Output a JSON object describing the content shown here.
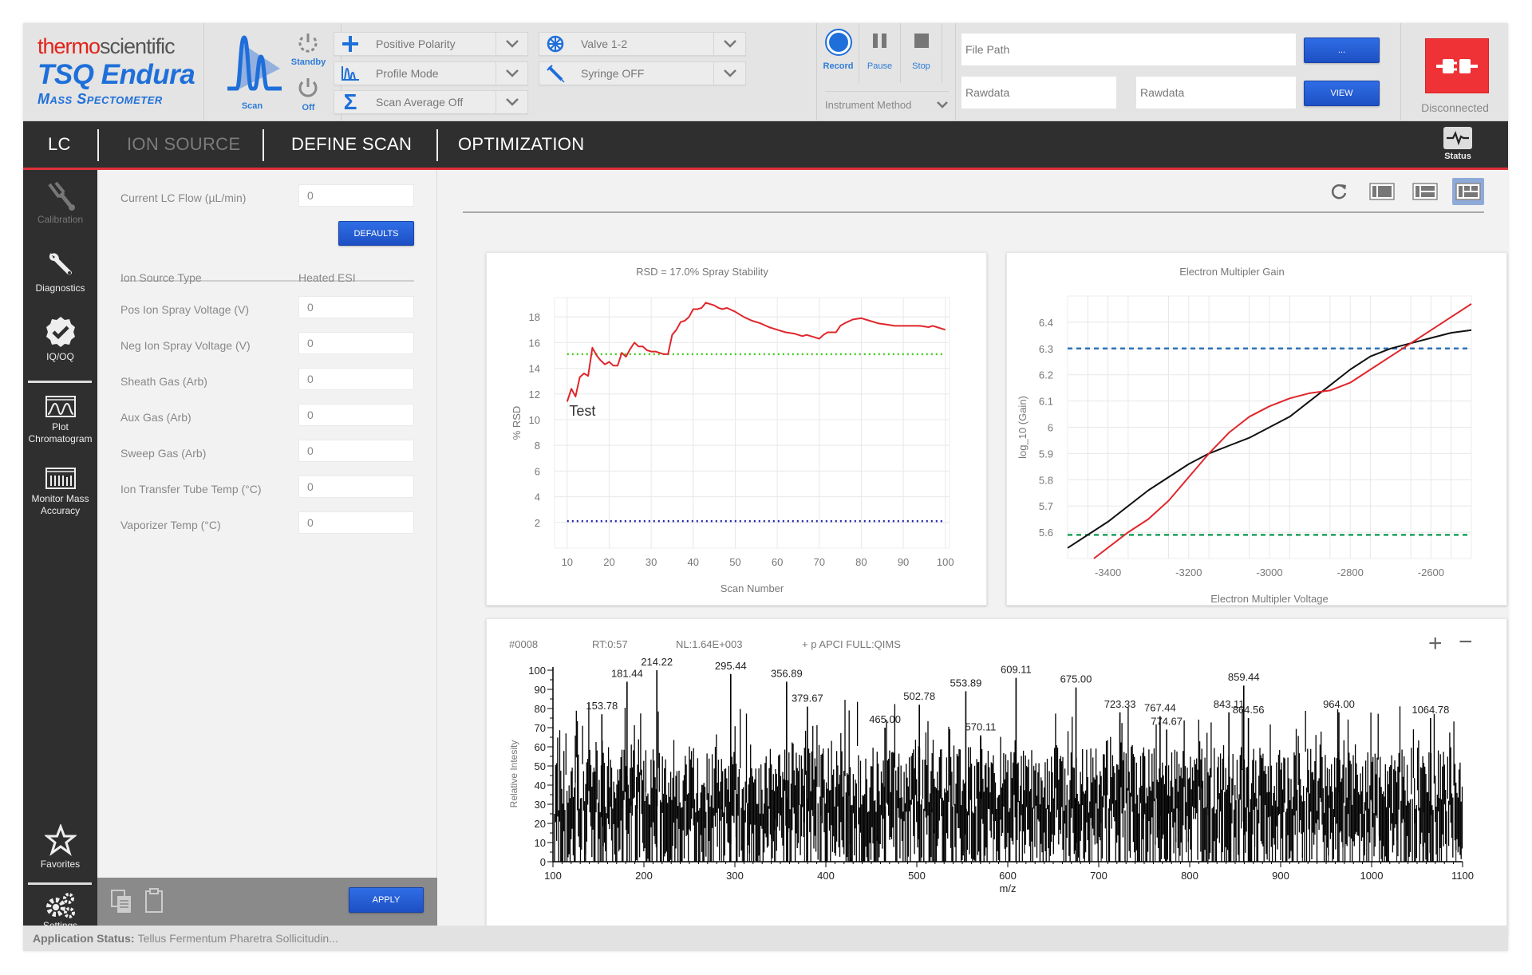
{
  "brand": {
    "company_part1": "thermo",
    "company_part2": "scientific",
    "product": "TSQ Endura",
    "subtitle": "Mass Spectometer"
  },
  "scan_controls": {
    "scan_label": "Scan",
    "standby_label": "Standby",
    "off_label": "Off"
  },
  "dropdowns": [
    {
      "icon": "plus-icon",
      "label": "Positive Polarity"
    },
    {
      "icon": "profile-peak-icon",
      "label": "Profile Mode"
    },
    {
      "icon": "sigma-icon",
      "label": "Scan Average Off"
    },
    {
      "icon": "valve-icon",
      "label": "Valve 1-2"
    },
    {
      "icon": "syringe-icon",
      "label": "Syringe OFF"
    }
  ],
  "recording": {
    "record_label": "Record",
    "pause_label": "Pause",
    "stop_label": "Stop",
    "instrument_method_label": "Instrument Method"
  },
  "file": {
    "file_path_placeholder": "File Path",
    "rawdata1_placeholder": "Rawdata",
    "rawdata2_placeholder": "Rawdata",
    "browse_label": "...",
    "view_label": "VIEW"
  },
  "connection": {
    "status_label": "Disconnected",
    "color": "#ee3236"
  },
  "tabs": [
    {
      "label": "LC",
      "state": "normal"
    },
    {
      "label": "ION SOURCE",
      "state": "active-muted"
    },
    {
      "label": "DEFINE SCAN",
      "state": "normal"
    },
    {
      "label": "OPTIMIZATION",
      "state": "normal"
    }
  ],
  "status_button_label": "Status",
  "sidebar": {
    "items": [
      {
        "label": "Calibration",
        "icon": "tuning-fork-icon",
        "disabled": true
      },
      {
        "label": "Diagnostics",
        "icon": "wrench-icon",
        "disabled": false
      },
      {
        "label": "IQ/OQ",
        "icon": "check-badge-icon",
        "disabled": false
      },
      {
        "label": "Plot Chromatogram",
        "icon": "chromatogram-icon",
        "disabled": false
      },
      {
        "label": "Monitor Mass Accuracy",
        "icon": "mass-accuracy-icon",
        "disabled": false
      },
      {
        "label": "Favorites",
        "icon": "star-icon",
        "disabled": false
      },
      {
        "label": "Settings",
        "icon": "gears-icon",
        "disabled": false
      }
    ]
  },
  "left_panel": {
    "lc_flow_label": "Current LC Flow (µL/min)",
    "lc_flow_value": "0",
    "defaults_label": "DEFAULTS",
    "ion_source_type_label": "Ion Source Type",
    "ion_source_type_value": "Heated ESI",
    "fields": [
      {
        "label": "Pos Ion Spray Voltage (V)",
        "value": "0"
      },
      {
        "label": "Neg Ion Spray Voltage (V)",
        "value": "0"
      },
      {
        "label": "Sheath Gas (Arb)",
        "value": "0"
      },
      {
        "label": "Aux Gas (Arb)",
        "value": "0"
      },
      {
        "label": "Sweep Gas (Arb)",
        "value": "0"
      },
      {
        "label": "Ion Transfer Tube Temp (°C)",
        "value": "0"
      },
      {
        "label": "Vaporizer Temp (°C)",
        "value": "0"
      }
    ],
    "apply_label": "APPLY"
  },
  "app_status": {
    "label": "Application Status:",
    "text": "Tellus Fermentum Pharetra Sollicitudin..."
  },
  "view_tools": [
    {
      "icon": "refresh-icon",
      "active": false
    },
    {
      "icon": "layout-single-icon",
      "active": false
    },
    {
      "icon": "layout-split-icon",
      "active": false
    },
    {
      "icon": "layout-grid-icon",
      "active": true
    }
  ],
  "spectrum_zoom": {
    "zoom_in": "+",
    "zoom_out": "−"
  },
  "chart_data": [
    {
      "type": "line",
      "title": "RSD  = 17.0% Spray Stability",
      "xlabel": "Scan Number",
      "ylabel": "% RSD",
      "xlim": [
        7,
        101
      ],
      "ylim": [
        0,
        19.5
      ],
      "xticks": [
        10,
        20,
        30,
        40,
        50,
        60,
        70,
        80,
        90,
        100
      ],
      "yticks": [
        2,
        4,
        6,
        8,
        10,
        12,
        14,
        16,
        18
      ],
      "grid": true,
      "annotation": "Test",
      "series": [
        {
          "name": "RSD",
          "color": "#e0262b",
          "x": [
            10,
            11,
            12,
            13,
            14,
            15,
            16,
            17,
            18,
            19,
            20,
            21,
            22,
            23,
            24,
            25,
            26,
            27,
            28,
            29,
            30,
            31,
            32,
            33,
            34,
            35,
            36,
            37,
            38,
            39,
            40,
            41,
            42,
            43,
            44,
            45,
            46,
            47,
            48,
            50,
            52,
            54,
            56,
            58,
            60,
            62,
            64,
            66,
            67,
            68,
            70,
            71,
            72,
            74,
            75,
            76,
            78,
            80,
            82,
            84,
            86,
            88,
            90,
            92,
            94,
            96,
            97,
            98,
            100
          ],
          "y": [
            11.4,
            12.4,
            11.8,
            13.3,
            13.6,
            13.4,
            15.6,
            15.0,
            14.6,
            14.3,
            14.5,
            14.2,
            14.2,
            15.2,
            14.9,
            15.5,
            16.0,
            15.7,
            15.7,
            15.4,
            15.3,
            15.3,
            15.2,
            15.1,
            15.1,
            16.6,
            17.0,
            17.6,
            17.7,
            18.0,
            18.6,
            18.6,
            18.7,
            19.1,
            19.0,
            18.9,
            18.7,
            18.6,
            18.7,
            18.4,
            18.0,
            17.7,
            17.5,
            17.2,
            17.0,
            16.8,
            16.7,
            16.5,
            16.6,
            16.5,
            16.3,
            16.6,
            16.8,
            16.8,
            17.3,
            17.5,
            17.8,
            17.9,
            17.7,
            17.5,
            17.4,
            17.3,
            17.3,
            17.3,
            17.3,
            17.2,
            17.3,
            17.2,
            17.0
          ]
        }
      ],
      "reference_lines": [
        {
          "name": "upper-limit",
          "y": 15.1,
          "color": "#44cc22",
          "style": "dotted"
        },
        {
          "name": "lower-limit",
          "y": 2.1,
          "color": "#2222aa",
          "style": "dotted"
        }
      ]
    },
    {
      "type": "line",
      "title": "Electron Multipler Gain",
      "xlabel": "Electron Multipler Voltage",
      "ylabel": "log_10 (Gain)",
      "xlim": [
        -3500,
        -2500
      ],
      "ylim": [
        5.5,
        6.5
      ],
      "xticks": [
        -3400,
        -3200,
        -3000,
        -2800,
        -2600
      ],
      "yticks": [
        5.6,
        5.7,
        5.8,
        5.9,
        6,
        6.1,
        6.2,
        6.3,
        6.4
      ],
      "grid": true,
      "series": [
        {
          "name": "measured",
          "color": "#111111",
          "x": [
            -3500,
            -3400,
            -3300,
            -3200,
            -3150,
            -3100,
            -3050,
            -3000,
            -2950,
            -2900,
            -2850,
            -2800,
            -2750,
            -2700,
            -2650,
            -2600,
            -2550,
            -2500
          ],
          "y": [
            5.54,
            5.64,
            5.76,
            5.86,
            5.9,
            5.93,
            5.96,
            6.0,
            6.04,
            6.1,
            6.16,
            6.22,
            6.27,
            6.3,
            6.32,
            6.34,
            6.36,
            6.37
          ]
        },
        {
          "name": "fit",
          "color": "#e0262b",
          "x": [
            -3435,
            -3350,
            -3300,
            -3250,
            -3200,
            -3150,
            -3100,
            -3050,
            -3000,
            -2950,
            -2900,
            -2850,
            -2800,
            -2750,
            -2700,
            -2650,
            -2600,
            -2550,
            -2500
          ],
          "y": [
            5.5,
            5.6,
            5.65,
            5.72,
            5.81,
            5.9,
            5.98,
            6.04,
            6.08,
            6.11,
            6.13,
            6.14,
            6.17,
            6.22,
            6.27,
            6.32,
            6.37,
            6.42,
            6.47
          ]
        }
      ],
      "reference_lines": [
        {
          "name": "upper-limit",
          "y": 6.3,
          "color": "#2f72b8",
          "style": "dashed"
        },
        {
          "name": "lower-limit",
          "y": 5.59,
          "color": "#1aa05a",
          "style": "dashed"
        }
      ]
    },
    {
      "type": "bar",
      "subtype": "mass-spectrum",
      "header": {
        "scan": "#0008",
        "rt": "RT:0:57",
        "nl": "NL:1.64E+003",
        "filter": "+ p APCI FULL:QIMS"
      },
      "xlabel": "m/z",
      "ylabel": "Relative Intesity",
      "xlim": [
        100,
        1100
      ],
      "ylim": [
        0,
        100
      ],
      "xticks": [
        100,
        200,
        300,
        400,
        500,
        600,
        700,
        800,
        900,
        1000,
        1100
      ],
      "yticks": [
        0,
        10,
        20,
        30,
        40,
        50,
        60,
        70,
        80,
        90,
        100
      ],
      "noise_baseline": "dense peaks, mostly 10-70% relative intensity across the full range",
      "labeled_peaks": [
        {
          "mz": 153.78,
          "intensity": 77
        },
        {
          "mz": 181.44,
          "intensity": 94
        },
        {
          "mz": 214.22,
          "intensity": 100
        },
        {
          "mz": 295.44,
          "intensity": 98
        },
        {
          "mz": 356.89,
          "intensity": 94
        },
        {
          "mz": 379.67,
          "intensity": 81
        },
        {
          "mz": 465.0,
          "intensity": 70
        },
        {
          "mz": 502.78,
          "intensity": 82
        },
        {
          "mz": 553.89,
          "intensity": 89
        },
        {
          "mz": 570.11,
          "intensity": 66
        },
        {
          "mz": 609.11,
          "intensity": 96
        },
        {
          "mz": 675.0,
          "intensity": 91
        },
        {
          "mz": 723.33,
          "intensity": 78
        },
        {
          "mz": 767.44,
          "intensity": 76
        },
        {
          "mz": 774.67,
          "intensity": 69
        },
        {
          "mz": 843.11,
          "intensity": 78
        },
        {
          "mz": 859.44,
          "intensity": 92
        },
        {
          "mz": 864.56,
          "intensity": 75
        },
        {
          "mz": 964.0,
          "intensity": 78
        },
        {
          "mz": 1064.78,
          "intensity": 75
        }
      ]
    }
  ]
}
